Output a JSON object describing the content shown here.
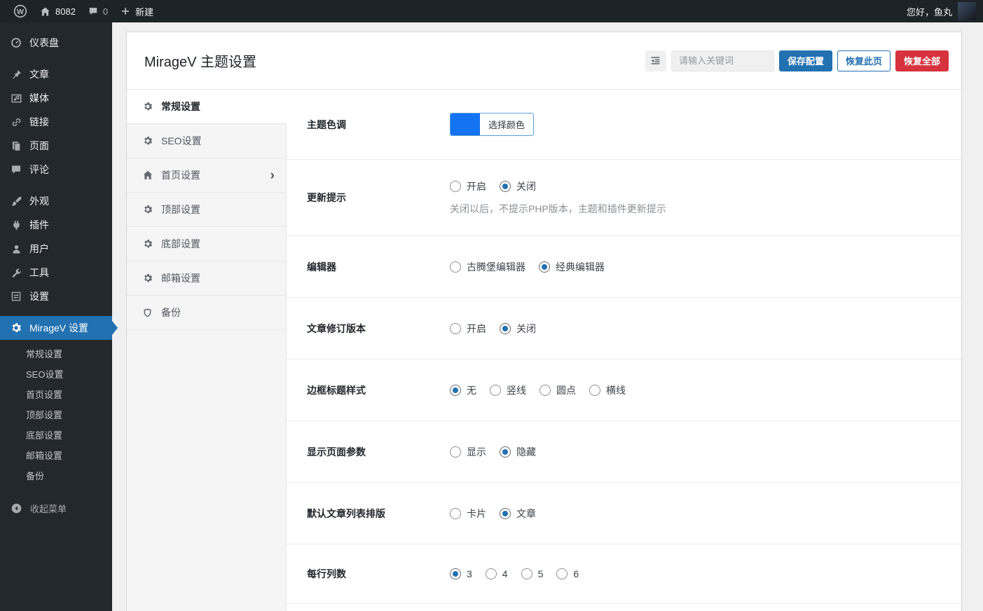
{
  "admin_bar": {
    "site_name": "8082",
    "comment_count": "0",
    "new_label": "新建",
    "greeting": "您好，鱼丸",
    "icons": [
      "wordpress-logo",
      "home-icon",
      "comments-icon",
      "plus-icon"
    ]
  },
  "sidebar": {
    "items": [
      {
        "label": "仪表盘",
        "icon": "dashboard-icon"
      },
      {
        "label": "文章",
        "icon": "pin-icon"
      },
      {
        "label": "媒体",
        "icon": "media-icon"
      },
      {
        "label": "链接",
        "icon": "link-icon"
      },
      {
        "label": "页面",
        "icon": "pages-icon"
      },
      {
        "label": "评论",
        "icon": "comments-icon"
      },
      {
        "label": "外观",
        "icon": "appearance-icon"
      },
      {
        "label": "插件",
        "icon": "plugin-icon"
      },
      {
        "label": "用户",
        "icon": "users-icon"
      },
      {
        "label": "工具",
        "icon": "tools-icon"
      },
      {
        "label": "设置",
        "icon": "settings-icon"
      },
      {
        "label": "MirageV 设置",
        "icon": "gear-icon",
        "active": true
      }
    ],
    "submenu": [
      "常规设置",
      "SEO设置",
      "首页设置",
      "顶部设置",
      "底部设置",
      "邮箱设置",
      "备份"
    ],
    "collapse_label": "收起菜单"
  },
  "page": {
    "title": "MirageV 主题设置",
    "search_placeholder": "请输入关键词",
    "buttons": {
      "save": "保存配置",
      "restore_page": "恢复此页",
      "restore_all": "恢复全部"
    },
    "tool_icon": "outdent-icon"
  },
  "tabs": [
    {
      "label": "常规设置",
      "icon": "gear-icon",
      "active": true
    },
    {
      "label": "SEO设置",
      "icon": "gear-icon",
      "active": false
    },
    {
      "label": "首页设置",
      "icon": "home-icon",
      "active": false,
      "chevron": "›"
    },
    {
      "label": "顶部设置",
      "icon": "gear-icon",
      "active": false
    },
    {
      "label": "底部设置",
      "icon": "gear-icon",
      "active": false
    },
    {
      "label": "邮箱设置",
      "icon": "gear-icon",
      "active": false
    },
    {
      "label": "备份",
      "icon": "shield-icon",
      "active": false
    }
  ],
  "settings": {
    "rows": [
      {
        "label": "主题色调",
        "type": "color-picker",
        "button_label": "选择颜色",
        "swatch_color": "#1473f0"
      },
      {
        "label": "更新提示",
        "type": "radio",
        "options": [
          {
            "label": "开启",
            "checked": false
          },
          {
            "label": "关闭",
            "checked": true
          }
        ],
        "description": "关闭以后，不提示PHP版本，主题和插件更新提示"
      },
      {
        "label": "编辑器",
        "type": "radio",
        "options": [
          {
            "label": "古腾堡编辑器",
            "checked": false
          },
          {
            "label": "经典编辑器",
            "checked": true
          }
        ]
      },
      {
        "label": "文章修订版本",
        "type": "radio",
        "options": [
          {
            "label": "开启",
            "checked": false
          },
          {
            "label": "关闭",
            "checked": true
          }
        ]
      },
      {
        "label": "边框标题样式",
        "type": "radio",
        "options": [
          {
            "label": "无",
            "checked": true
          },
          {
            "label": "竖线",
            "checked": false
          },
          {
            "label": "圆点",
            "checked": false
          },
          {
            "label": "横线",
            "checked": false
          }
        ]
      },
      {
        "label": "显示页面参数",
        "type": "radio",
        "options": [
          {
            "label": "显示",
            "checked": false
          },
          {
            "label": "隐藏",
            "checked": true
          }
        ]
      },
      {
        "label": "默认文章列表排版",
        "type": "radio",
        "options": [
          {
            "label": "卡片",
            "checked": false
          },
          {
            "label": "文章",
            "checked": true
          }
        ]
      },
      {
        "label": "每行列数",
        "type": "radio",
        "options": [
          {
            "label": "3",
            "checked": true
          },
          {
            "label": "4",
            "checked": false
          },
          {
            "label": "5",
            "checked": false
          },
          {
            "label": "6",
            "checked": false
          }
        ]
      }
    ]
  },
  "colors": {
    "accent": "#2271b1",
    "danger": "#d6333f",
    "theme_swatch": "#1473f0",
    "admin_bar_bg": "#1d2327",
    "sidebar_bg": "#23282d"
  }
}
